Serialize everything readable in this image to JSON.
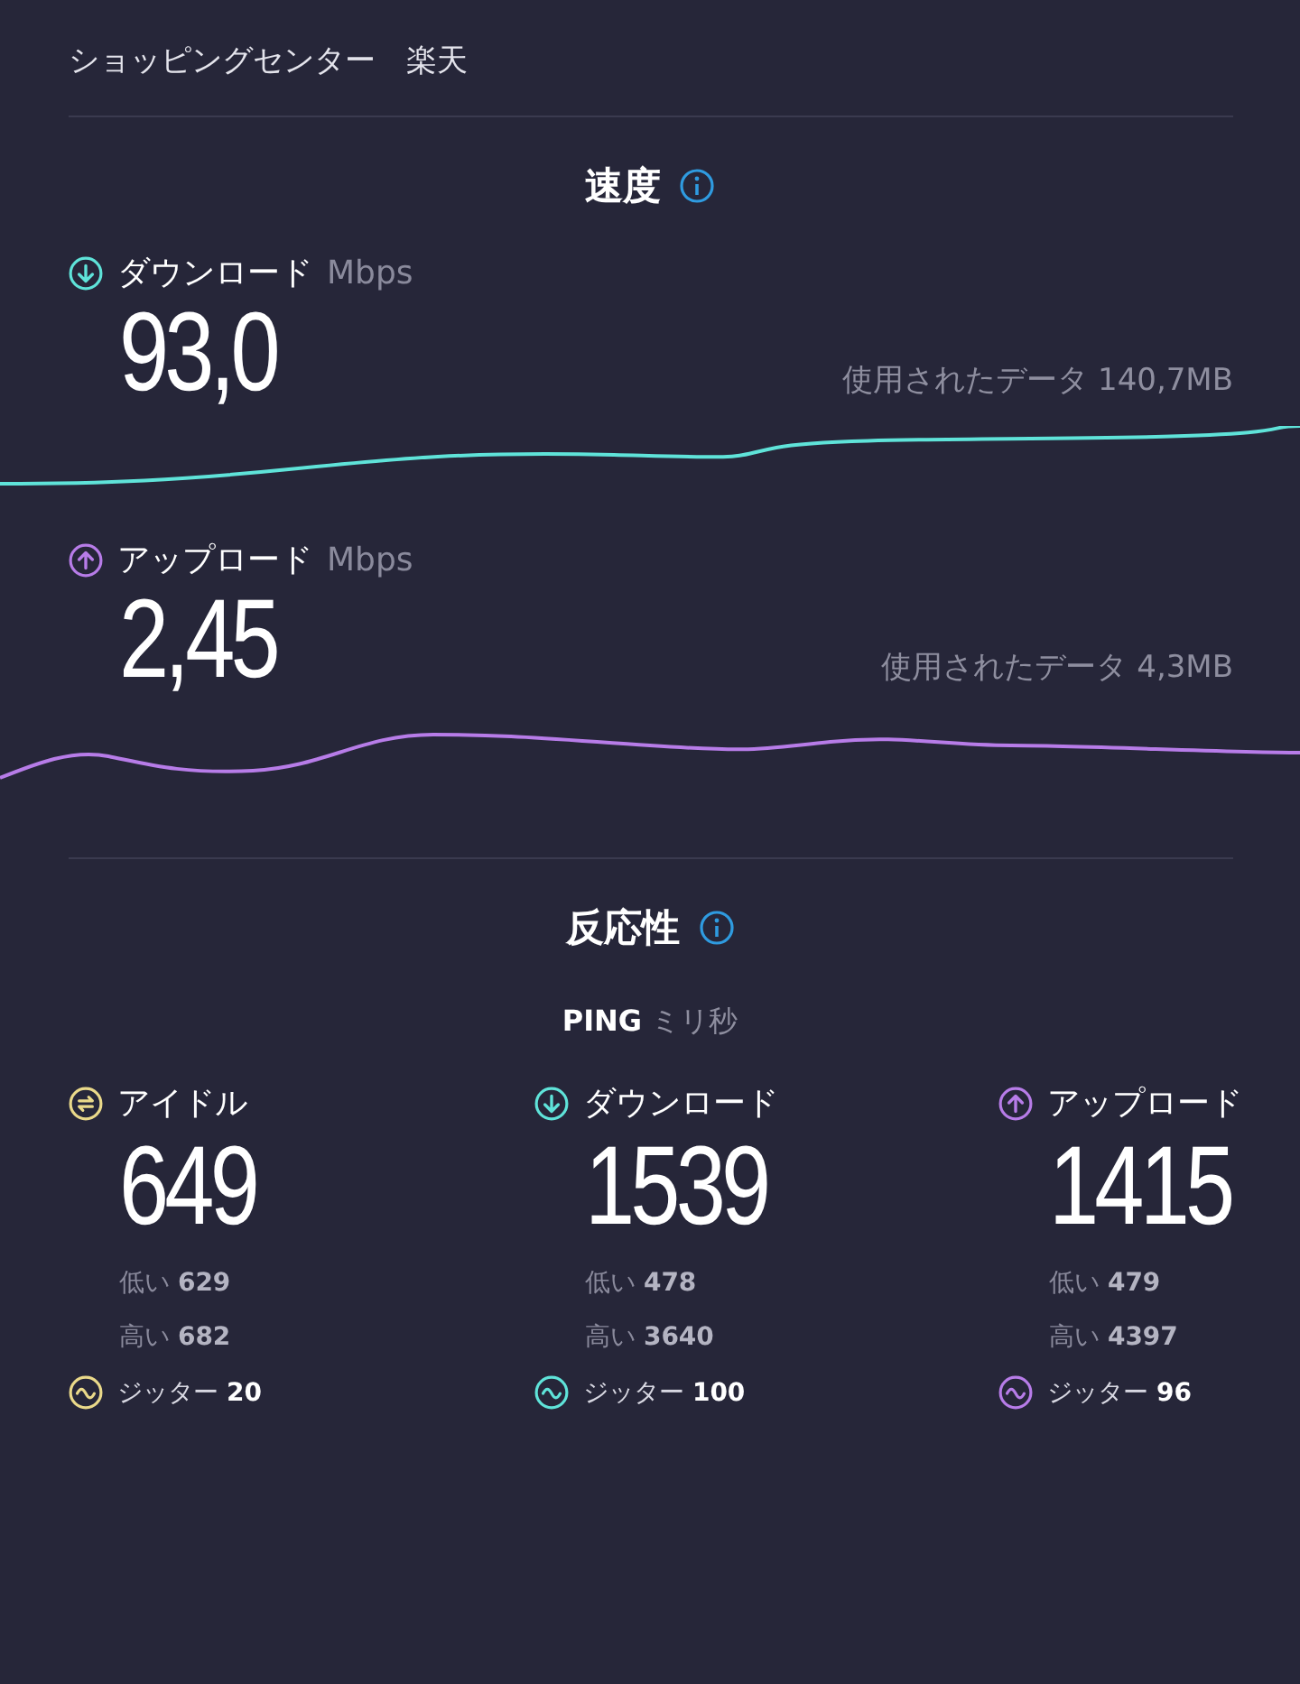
{
  "header": {
    "title": "ショッピングセンター　楽天"
  },
  "speed": {
    "title": "速度",
    "metrics": [
      {
        "kind": "download",
        "color": "#5fe3d9",
        "label": "ダウンロード",
        "unit": "Mbps",
        "value": "93,0",
        "data_used": "使用されたデータ 140,7MB"
      },
      {
        "kind": "upload",
        "color": "#b77ce8",
        "label": "アップロード",
        "unit": "Mbps",
        "value": "2,45",
        "data_used": "使用されたデータ 4,3MB"
      }
    ]
  },
  "responsiveness": {
    "title": "反応性",
    "ping_label": "**PING** ミリ秒",
    "columns": [
      {
        "kind": "idle",
        "color": "#ead98a",
        "label": "アイドル",
        "value": "649",
        "low": "低い **629**",
        "high": "高い **682**",
        "jitter": "ジッター **20**"
      },
      {
        "kind": "download",
        "color": "#5fe3d9",
        "label": "ダウンロード",
        "value": "1539",
        "low": "低い **478**",
        "high": "高い **3640**",
        "jitter": "ジッター **100**"
      },
      {
        "kind": "upload",
        "color": "#b77ce8",
        "label": "アップロード",
        "value": "1415",
        "low": "低い **479**",
        "high": "高い **4397**",
        "jitter": "ジッター **96**"
      }
    ]
  }
}
